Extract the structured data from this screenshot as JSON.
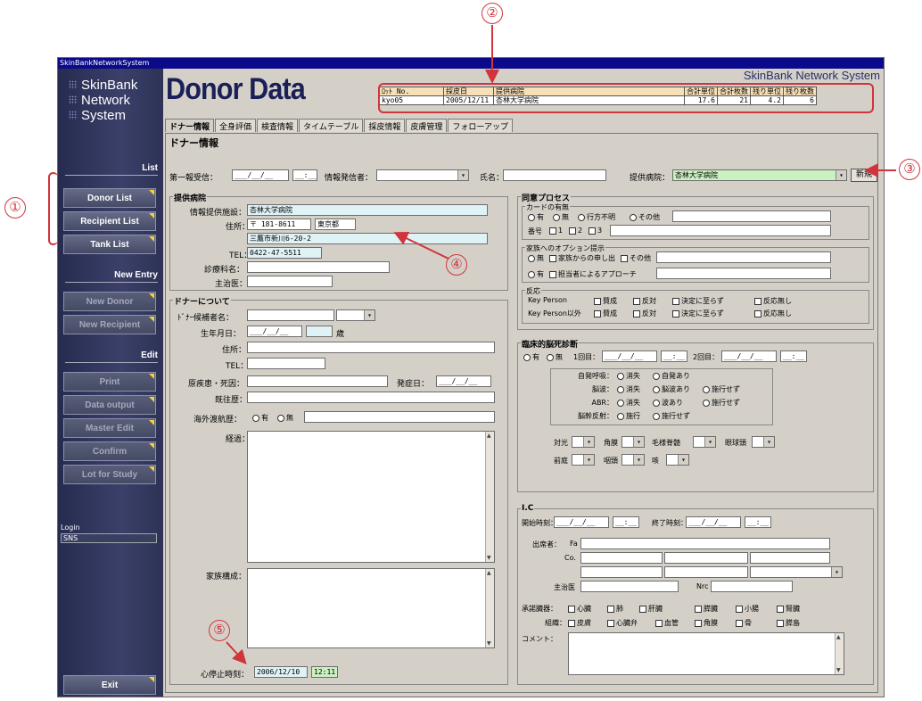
{
  "window": {
    "title": "SkinBankNetworkSystem"
  },
  "sidebar": {
    "logo": [
      "SkinBank",
      "Network",
      "System"
    ],
    "list_heading": "List",
    "list_items": [
      "Donor List",
      "Recipient List",
      "Tank List"
    ],
    "new_heading": "New Entry",
    "new_items": [
      "New Donor",
      "New Recipient"
    ],
    "edit_heading": "Edit",
    "edit_items": [
      "Print",
      "Data output",
      "Master Edit",
      "Confirm",
      "Lot for Study"
    ],
    "login_label": "Login",
    "login_value": "SNS",
    "exit": "Exit"
  },
  "header": {
    "title": "Donor Data",
    "brand": "SkinBank Network System"
  },
  "info_table": {
    "headers": [
      "ﾛｯﾄ No.",
      "採皮日",
      "提供病院",
      "合計単位",
      "合計枚数",
      "残り単位",
      "残り枚数"
    ],
    "row": [
      "kyo05",
      "2005/12/11",
      "杏林大学病院",
      "17.6",
      "21",
      "4.2",
      "6"
    ]
  },
  "tabs": [
    "ドナー情報",
    "全身評価",
    "検査情報",
    "タイムテーブル",
    "採皮情報",
    "皮膚管理",
    "フォローアップ"
  ],
  "panel_title": "ドナー情報",
  "top_row": {
    "first_report": "第一報受信：",
    "date_ph": "___/__/__",
    "time_ph": "__:__",
    "informant": "情報発信者：",
    "name": "氏名：",
    "hospital_label": "提供病院：",
    "hospital_value": "杏林大学病院",
    "new_button": "新規"
  },
  "provider": {
    "title": "提供病院",
    "facility_label": "情報提供施設：",
    "facility": "杏林大学病院",
    "address_label": "住所：",
    "zip": "〒 181-8611",
    "pref": "東京都",
    "street": "三鷹市新川6-20-2",
    "tel_label": "TEL：",
    "tel": "0422-47-5511",
    "dept_label": "診療科名：",
    "doctor_label": "主治医："
  },
  "donor": {
    "title": "ドナーについて",
    "candidate": "ﾄﾞﾅｰ候補者名：",
    "birth": "生年月日：",
    "birth_ph": "___/__/__",
    "age_unit": "歳",
    "address": "住所：",
    "tel": "TEL：",
    "disease": "原疾患・死因：",
    "onset": "発症日：",
    "onset_ph": "___/__/__",
    "history": "既往歴：",
    "travel": "海外渡航歴：",
    "yes": "有",
    "no": "無",
    "course": "経過：",
    "family": "家族構成：",
    "arrest": "心停止時刻：",
    "arrest_date": "2006/12/10",
    "arrest_time": "12:11"
  },
  "consent": {
    "title": "同意プロセス",
    "card": "カードの有無",
    "card_opts": [
      "有",
      "無",
      "行方不明",
      "その他"
    ],
    "number": "番号",
    "number_opts": [
      "1",
      "2",
      "3"
    ],
    "option": "家族へのオプション提示",
    "opt_row1": [
      "無",
      "家族からの申し出",
      "その他"
    ],
    "opt_row2": [
      "有",
      "担当者によるアプローチ"
    ],
    "reaction": "反応",
    "kp": "Key Person",
    "kp_other": "Key Person以外",
    "react_opts": [
      "賛成",
      "反対",
      "決定に至らず",
      "反応無し"
    ]
  },
  "brain": {
    "title": "臨床的脳死診断",
    "yes": "有",
    "no": "無",
    "first": "1回目：",
    "second": "2回目：",
    "date_ph": "___/__/__",
    "time_ph": "__:__",
    "rows": [
      {
        "label": "自発呼吸：",
        "opts": [
          "消失",
          "自発あり"
        ]
      },
      {
        "label": "脳波：",
        "opts": [
          "消失",
          "脳波あり",
          "施行せず"
        ]
      },
      {
        "label": "ABR：",
        "opts": [
          "消失",
          "波あり",
          "施行せず"
        ]
      },
      {
        "label": "脳幹反射：",
        "opts": [
          "施行",
          "施行せず"
        ]
      }
    ],
    "reflex1": [
      "対光",
      "角膜",
      "毛様脊髄",
      "眼球頭"
    ],
    "reflex2": [
      "前庭",
      "咽頭",
      "咳"
    ]
  },
  "ic": {
    "title": "I.C",
    "start": "開始時刻：",
    "end": "終了時刻：",
    "date_ph": "___/__/__",
    "time_ph": "__:__",
    "attend": "出席者：",
    "fa": "Fa",
    "co": "Co.",
    "doctor": "主治医",
    "nrc": "Nrc",
    "organs_label": "承諾臓器：",
    "organs": [
      "心臓",
      "肺",
      "肝臓",
      "膵臓",
      "小腸",
      "腎臓"
    ],
    "tissue_label": "組織：",
    "tissues": [
      "皮膚",
      "心臓弁",
      "血管",
      "角膜",
      "骨",
      "膵島"
    ],
    "comment": "コメント："
  },
  "annotations": [
    "①",
    "②",
    "③",
    "④",
    "⑤"
  ],
  "colors": {
    "annotation": "#d0343d",
    "sidebar": "#2d3256",
    "title": "#1a1f58"
  }
}
